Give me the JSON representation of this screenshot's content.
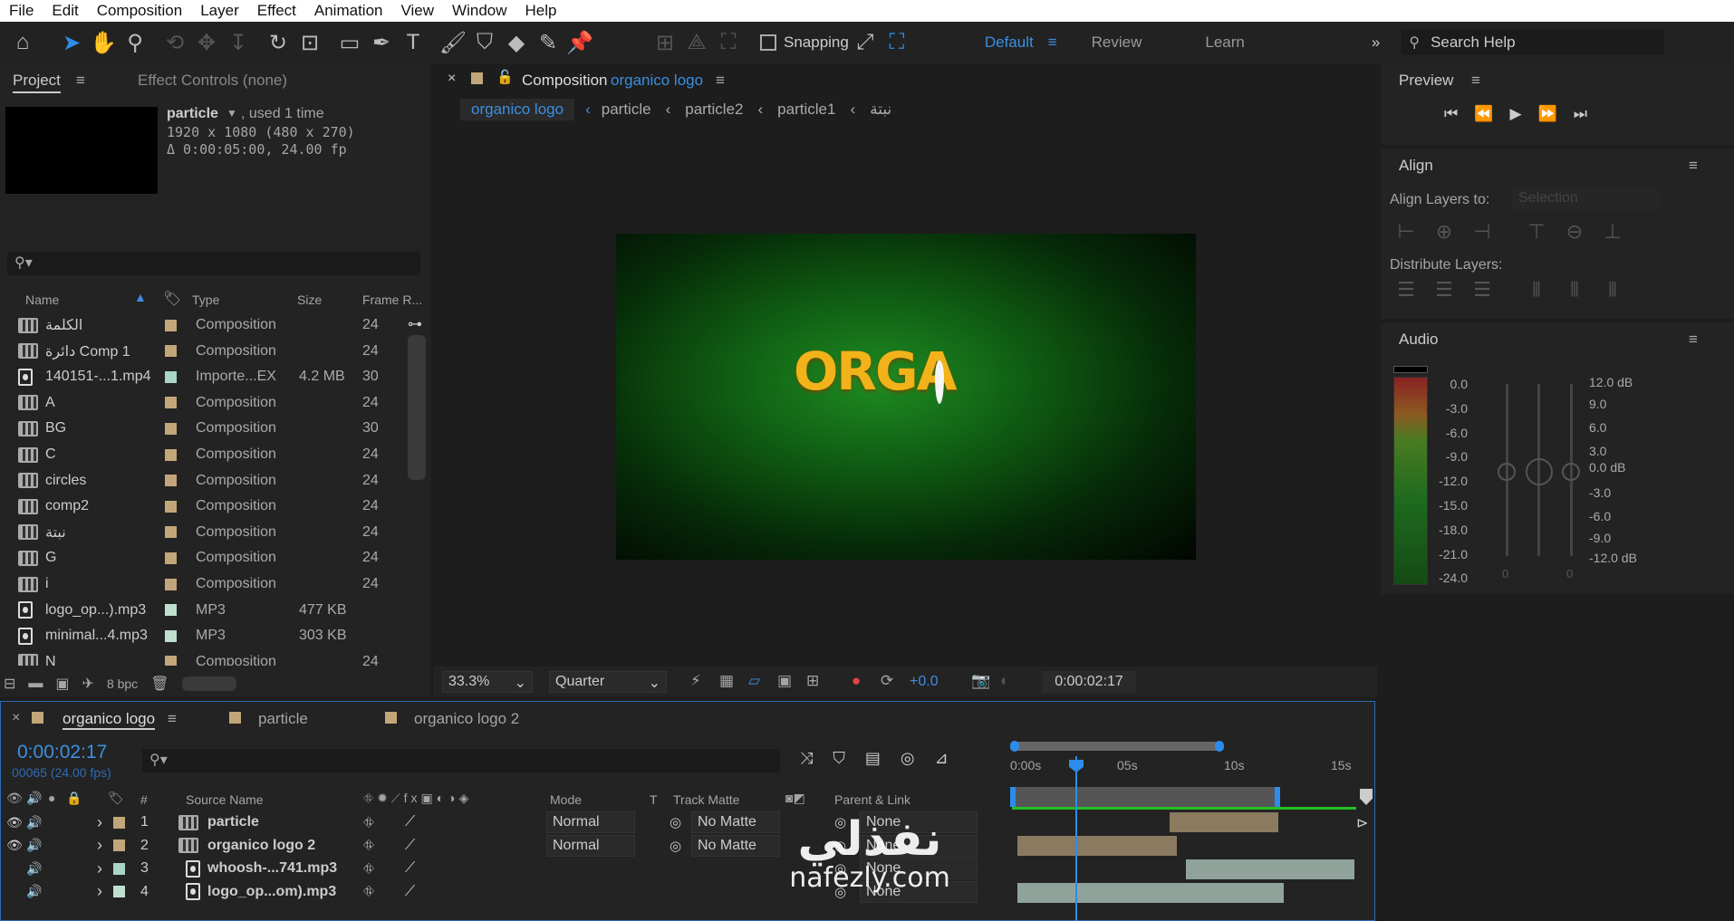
{
  "menu": [
    "File",
    "Edit",
    "Composition",
    "Layer",
    "Effect",
    "Animation",
    "View",
    "Window",
    "Help"
  ],
  "toolbar": {
    "snapping": "Snapping",
    "workspaces": [
      "Default",
      "Review",
      "Learn"
    ],
    "search_placeholder": "Search Help"
  },
  "project": {
    "tab": "Project",
    "effect_controls": "Effect Controls (none)",
    "selected_name": "particle",
    "used": ", used 1 time",
    "dims": "1920 x 1080  (480 x 270) (1.00)",
    "duration": "Δ 0:00:05:00, 24.00 fp",
    "columns": [
      "Name",
      "Type",
      "Size",
      "Frame R..."
    ],
    "items": [
      {
        "name": "الكلمة",
        "type": "Composition",
        "size": "",
        "rate": "24",
        "kind": "comp",
        "label": "#c2a679"
      },
      {
        "name": "دائرة Comp 1",
        "type": "Composition",
        "size": "",
        "rate": "24",
        "kind": "comp",
        "label": "#c2a679"
      },
      {
        "name": "140151-...1.mp4",
        "type": "Importe...EX",
        "size": "4.2 MB",
        "rate": "30",
        "kind": "file",
        "label": "#a8d5c8"
      },
      {
        "name": "A",
        "type": "Composition",
        "size": "",
        "rate": "24",
        "kind": "comp",
        "label": "#c2a679"
      },
      {
        "name": "BG",
        "type": "Composition",
        "size": "",
        "rate": "30",
        "kind": "comp",
        "label": "#c2a679"
      },
      {
        "name": "C",
        "type": "Composition",
        "size": "",
        "rate": "24",
        "kind": "comp",
        "label": "#c2a679"
      },
      {
        "name": "circles",
        "type": "Composition",
        "size": "",
        "rate": "24",
        "kind": "comp",
        "label": "#c2a679"
      },
      {
        "name": "comp2",
        "type": "Composition",
        "size": "",
        "rate": "24",
        "kind": "comp",
        "label": "#c2a679"
      },
      {
        "name": "نبتة",
        "type": "Composition",
        "size": "",
        "rate": "24",
        "kind": "comp",
        "label": "#c2a679"
      },
      {
        "name": "G",
        "type": "Composition",
        "size": "",
        "rate": "24",
        "kind": "comp",
        "label": "#c2a679"
      },
      {
        "name": "i",
        "type": "Composition",
        "size": "",
        "rate": "24",
        "kind": "comp",
        "label": "#c2a679"
      },
      {
        "name": "logo_op...).mp3",
        "type": "MP3",
        "size": "477 KB",
        "rate": "",
        "kind": "file",
        "label": "#bfe0cf"
      },
      {
        "name": "minimal...4.mp3",
        "type": "MP3",
        "size": "303 KB",
        "rate": "",
        "kind": "file",
        "label": "#bfe0cf"
      },
      {
        "name": "N",
        "type": "Composition",
        "size": "",
        "rate": "24",
        "kind": "comp",
        "label": "#c2a679"
      }
    ],
    "bpc": "8 bpc"
  },
  "comp": {
    "tab_prefix": "Composition",
    "tab_name": "organico logo",
    "breadcrumbs": [
      "organico logo",
      "particle",
      "particle2",
      "particle1",
      "نبتة"
    ],
    "logo_text": "ORGA",
    "zoom": "33.3%",
    "resolution": "Quarter",
    "exposure": "+0.0",
    "timecode": "0:00:02:17"
  },
  "preview": {
    "title": "Preview"
  },
  "align": {
    "title": "Align",
    "align_to_label": "Align Layers to:",
    "align_to_value": "Selection",
    "distribute": "Distribute Layers:"
  },
  "audio": {
    "title": "Audio",
    "left_scale": [
      "0.0",
      "-3.0",
      "-6.0",
      "-9.0",
      "-12.0",
      "-15.0",
      "-18.0",
      "-21.0",
      "-24.0"
    ],
    "right_scale": [
      "12.0 dB",
      "9.0",
      "6.0",
      "3.0",
      "0.0 dB",
      "-3.0",
      "-6.0",
      "-9.0",
      "-12.0 dB"
    ],
    "slider_zero_l": "0",
    "slider_zero_r": "0"
  },
  "timeline": {
    "tabs": [
      "organico logo",
      "particle",
      "organico logo 2"
    ],
    "timecode": "0:00:02:17",
    "frames": "00065 (24.00 fps)",
    "col_hash": "#",
    "col_source": "Source Name",
    "col_mode": "Mode",
    "col_t": "T",
    "col_matte": "Track Matte",
    "col_parent": "Parent & Link",
    "ruler": [
      "0:00s",
      "05s",
      "10s",
      "15s"
    ],
    "layers": [
      {
        "num": "1",
        "name": "particle",
        "mode": "Normal",
        "matte": "No Matte",
        "parent": "None",
        "label": "#c2a679",
        "kind": "comp",
        "bar_color": "#8b7a5f"
      },
      {
        "num": "2",
        "name": "organico logo 2",
        "mode": "Normal",
        "matte": "No Matte",
        "parent": "None",
        "label": "#c2a679",
        "kind": "comp",
        "bar_color": "#8b7a5f"
      },
      {
        "num": "3",
        "name": "whoosh-...741.mp3",
        "mode": "",
        "matte": "",
        "parent": "None",
        "label": "#a8d5c8",
        "kind": "file",
        "bar_color": "#8fa39a"
      },
      {
        "num": "4",
        "name": "logo_op...om).mp3",
        "mode": "",
        "matte": "",
        "parent": "None",
        "label": "#bfe0cf",
        "kind": "file",
        "bar_color": "#8fa39a"
      }
    ]
  },
  "watermark": {
    "arabic": "نفذلي",
    "latin": "nafezly.com"
  }
}
